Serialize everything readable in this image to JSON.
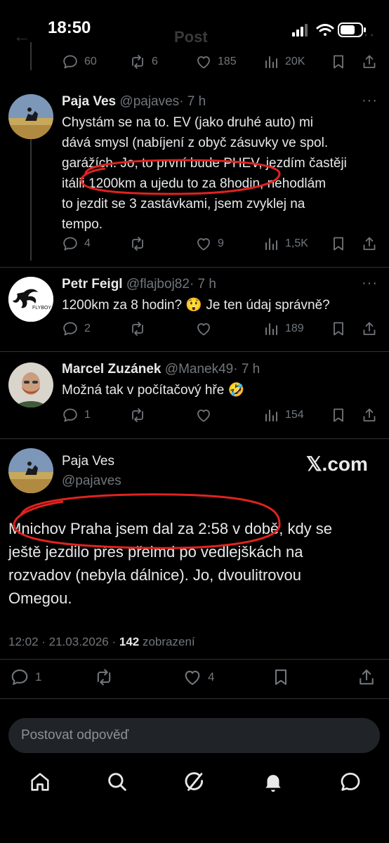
{
  "status_bar": {
    "time": "18:50"
  },
  "header_ghost": {
    "title": "Post"
  },
  "top_actions": {
    "replies": "60",
    "retweets": "6",
    "likes": "185",
    "views": "20K"
  },
  "tweets": [
    {
      "name": "Paja Ves",
      "handle": "@pajaves",
      "time": "· 7 h",
      "lines": [
        "Chystám se na to. EV (jako druhé auto) mi",
        "dává smysl (nabíjení z obyč zásuvky ve spol.",
        "garážích. Jo, to první bude PHEV, jezdím častěji",
        "itálii 1200km a ujedu to za 8hodin, nehodlám",
        "to jezdit se 3 zastávkami, jsem zvyklej na",
        "tempo."
      ],
      "replies": "4",
      "retweets": "",
      "likes": "9",
      "views": "1,5K"
    },
    {
      "name": "Petr Feigl",
      "handle": "@flajboj82",
      "time": "· 7 h",
      "lines": [
        "1200km za 8 hodin? 😲 Je ten údaj správně?"
      ],
      "replies": "2",
      "retweets": "",
      "likes": "",
      "views": "189"
    },
    {
      "name": "Marcel Zuzánek",
      "handle": "@Manek49",
      "time": "· 7 h",
      "lines": [
        "Možná tak v počítačový hře 🤣"
      ],
      "replies": "1",
      "retweets": "",
      "likes": "",
      "views": "154"
    }
  ],
  "main_tweet": {
    "name": "Paja Ves",
    "handle": "@pajaves",
    "brand": "𝕏.com",
    "lines": [
      "Mnichov Praha jsem dal za 2:58 v době, kdy se",
      "ještě jezdilo přes přeimd po vedlejškách na",
      "rozvadov (nebyla dálnice). Jo, dvoulitrovou",
      "Omegou."
    ],
    "timestamp": "12:02 · 21.03.2026 ·",
    "views_count": "142",
    "views_label": "zobrazení",
    "replies": "1",
    "likes": "4"
  },
  "reply_box": {
    "placeholder": "Postovat odpověď"
  },
  "bottom_nav": [
    "home-icon",
    "search-icon",
    "grok-icon",
    "notifications-icon",
    "messages-icon"
  ],
  "colors": {
    "background": "#000000",
    "text": "#e7e9ea",
    "muted": "#71767b",
    "annotation": "#e0231f"
  }
}
